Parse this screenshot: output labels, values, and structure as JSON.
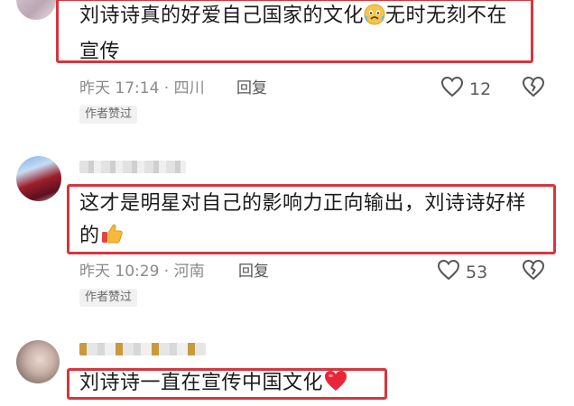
{
  "comments": [
    {
      "text_line1": "刘诗诗真的好爱自己国家的文化",
      "text_line1_after": "无时无刻不在",
      "text_line2": "宣传",
      "emoji": "fearful-face-icon",
      "time_location": "昨天 17:14 · 四川",
      "reply_label": "回复",
      "like_count": "12",
      "badge": "作者赞过"
    },
    {
      "text_line1": "这才是明星对自己的影响力正向输出，刘诗诗好样",
      "text_line2": "的",
      "emoji": "thumbs-up-icon",
      "time_location": "昨天 10:29 · 河南",
      "reply_label": "回复",
      "like_count": "53",
      "badge": "作者赞过"
    },
    {
      "text_line1": "刘诗诗一直在宣传中国文化",
      "emoji": "red-heart-icon"
    }
  ],
  "colors": {
    "highlight_box": "#d6363c",
    "meta_text": "#8a8a8a"
  }
}
